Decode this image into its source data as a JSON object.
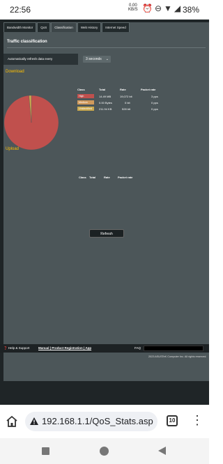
{
  "statusbar": {
    "time": "22:56",
    "net_speed": "0.00",
    "net_unit": "KB/S",
    "battery": "38%"
  },
  "tabs": [
    {
      "label": "Bandwidth Monitor"
    },
    {
      "label": "QoS"
    },
    {
      "label": "Classification",
      "active": true
    },
    {
      "label": "Web History"
    },
    {
      "label": "Internet Speed"
    }
  ],
  "page_title": "Traffic classification",
  "refresh": {
    "label": "Automatically refresh data every",
    "selected": "3 seconds"
  },
  "download": {
    "title": "Download",
    "headers": {
      "class": "Class",
      "total": "Total",
      "rate": "Rate",
      "packet_rate": "Packet rate"
    },
    "rows": [
      {
        "class": "High",
        "total": "14.49 MB",
        "rate": "19,072 bit",
        "packet_rate": "3 pps",
        "color": "#c0504d"
      },
      {
        "class": "Medium",
        "total": "0.00 Bytes",
        "rate": "0 bit",
        "packet_rate": "0 pps",
        "color": "#d09a5c"
      },
      {
        "class": "Unidentified",
        "total": "211.94 KB",
        "rate": "528 bit",
        "packet_rate": "0 pps",
        "color": "#c9a84e"
      }
    ],
    "chart_data": {
      "type": "pie",
      "categories": [
        "High",
        "Medium",
        "Unidentified"
      ],
      "values": [
        14.49,
        0,
        0.207
      ],
      "colors": [
        "#c0504d",
        "#d09a5c",
        "#c9a84e"
      ]
    }
  },
  "upload": {
    "title": "Upload",
    "headers": {
      "class": "Class",
      "total": "Total",
      "rate": "Rate",
      "packet_rate": "Packet rate"
    }
  },
  "refresh_button": "Refresh",
  "footer": {
    "help": "Help & Support",
    "links": "Manual | Product Registration | App",
    "faq": "FAQ",
    "copyright": "2023 ASUSTeK Computer Inc. All rights reserved."
  },
  "browser": {
    "url": "192.168.1.1/QoS_Stats.asp",
    "tab_count": "10"
  }
}
